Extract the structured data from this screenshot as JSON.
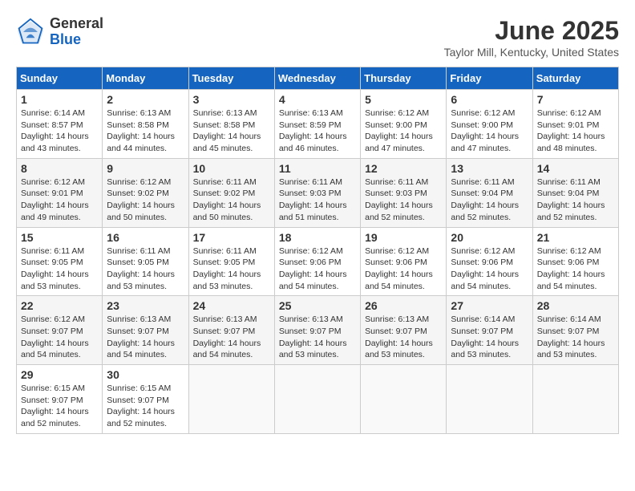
{
  "header": {
    "logo_line1": "General",
    "logo_line2": "Blue",
    "month_year": "June 2025",
    "location": "Taylor Mill, Kentucky, United States"
  },
  "weekdays": [
    "Sunday",
    "Monday",
    "Tuesday",
    "Wednesday",
    "Thursday",
    "Friday",
    "Saturday"
  ],
  "weeks": [
    [
      {
        "day": "1",
        "info": "Sunrise: 6:14 AM\nSunset: 8:57 PM\nDaylight: 14 hours\nand 43 minutes."
      },
      {
        "day": "2",
        "info": "Sunrise: 6:13 AM\nSunset: 8:58 PM\nDaylight: 14 hours\nand 44 minutes."
      },
      {
        "day": "3",
        "info": "Sunrise: 6:13 AM\nSunset: 8:58 PM\nDaylight: 14 hours\nand 45 minutes."
      },
      {
        "day": "4",
        "info": "Sunrise: 6:13 AM\nSunset: 8:59 PM\nDaylight: 14 hours\nand 46 minutes."
      },
      {
        "day": "5",
        "info": "Sunrise: 6:12 AM\nSunset: 9:00 PM\nDaylight: 14 hours\nand 47 minutes."
      },
      {
        "day": "6",
        "info": "Sunrise: 6:12 AM\nSunset: 9:00 PM\nDaylight: 14 hours\nand 47 minutes."
      },
      {
        "day": "7",
        "info": "Sunrise: 6:12 AM\nSunset: 9:01 PM\nDaylight: 14 hours\nand 48 minutes."
      }
    ],
    [
      {
        "day": "8",
        "info": "Sunrise: 6:12 AM\nSunset: 9:01 PM\nDaylight: 14 hours\nand 49 minutes."
      },
      {
        "day": "9",
        "info": "Sunrise: 6:12 AM\nSunset: 9:02 PM\nDaylight: 14 hours\nand 50 minutes."
      },
      {
        "day": "10",
        "info": "Sunrise: 6:11 AM\nSunset: 9:02 PM\nDaylight: 14 hours\nand 50 minutes."
      },
      {
        "day": "11",
        "info": "Sunrise: 6:11 AM\nSunset: 9:03 PM\nDaylight: 14 hours\nand 51 minutes."
      },
      {
        "day": "12",
        "info": "Sunrise: 6:11 AM\nSunset: 9:03 PM\nDaylight: 14 hours\nand 52 minutes."
      },
      {
        "day": "13",
        "info": "Sunrise: 6:11 AM\nSunset: 9:04 PM\nDaylight: 14 hours\nand 52 minutes."
      },
      {
        "day": "14",
        "info": "Sunrise: 6:11 AM\nSunset: 9:04 PM\nDaylight: 14 hours\nand 52 minutes."
      }
    ],
    [
      {
        "day": "15",
        "info": "Sunrise: 6:11 AM\nSunset: 9:05 PM\nDaylight: 14 hours\nand 53 minutes."
      },
      {
        "day": "16",
        "info": "Sunrise: 6:11 AM\nSunset: 9:05 PM\nDaylight: 14 hours\nand 53 minutes."
      },
      {
        "day": "17",
        "info": "Sunrise: 6:11 AM\nSunset: 9:05 PM\nDaylight: 14 hours\nand 53 minutes."
      },
      {
        "day": "18",
        "info": "Sunrise: 6:12 AM\nSunset: 9:06 PM\nDaylight: 14 hours\nand 54 minutes."
      },
      {
        "day": "19",
        "info": "Sunrise: 6:12 AM\nSunset: 9:06 PM\nDaylight: 14 hours\nand 54 minutes."
      },
      {
        "day": "20",
        "info": "Sunrise: 6:12 AM\nSunset: 9:06 PM\nDaylight: 14 hours\nand 54 minutes."
      },
      {
        "day": "21",
        "info": "Sunrise: 6:12 AM\nSunset: 9:06 PM\nDaylight: 14 hours\nand 54 minutes."
      }
    ],
    [
      {
        "day": "22",
        "info": "Sunrise: 6:12 AM\nSunset: 9:07 PM\nDaylight: 14 hours\nand 54 minutes."
      },
      {
        "day": "23",
        "info": "Sunrise: 6:13 AM\nSunset: 9:07 PM\nDaylight: 14 hours\nand 54 minutes."
      },
      {
        "day": "24",
        "info": "Sunrise: 6:13 AM\nSunset: 9:07 PM\nDaylight: 14 hours\nand 54 minutes."
      },
      {
        "day": "25",
        "info": "Sunrise: 6:13 AM\nSunset: 9:07 PM\nDaylight: 14 hours\nand 53 minutes."
      },
      {
        "day": "26",
        "info": "Sunrise: 6:13 AM\nSunset: 9:07 PM\nDaylight: 14 hours\nand 53 minutes."
      },
      {
        "day": "27",
        "info": "Sunrise: 6:14 AM\nSunset: 9:07 PM\nDaylight: 14 hours\nand 53 minutes."
      },
      {
        "day": "28",
        "info": "Sunrise: 6:14 AM\nSunset: 9:07 PM\nDaylight: 14 hours\nand 53 minutes."
      }
    ],
    [
      {
        "day": "29",
        "info": "Sunrise: 6:15 AM\nSunset: 9:07 PM\nDaylight: 14 hours\nand 52 minutes."
      },
      {
        "day": "30",
        "info": "Sunrise: 6:15 AM\nSunset: 9:07 PM\nDaylight: 14 hours\nand 52 minutes."
      },
      {
        "day": "",
        "info": ""
      },
      {
        "day": "",
        "info": ""
      },
      {
        "day": "",
        "info": ""
      },
      {
        "day": "",
        "info": ""
      },
      {
        "day": "",
        "info": ""
      }
    ]
  ]
}
